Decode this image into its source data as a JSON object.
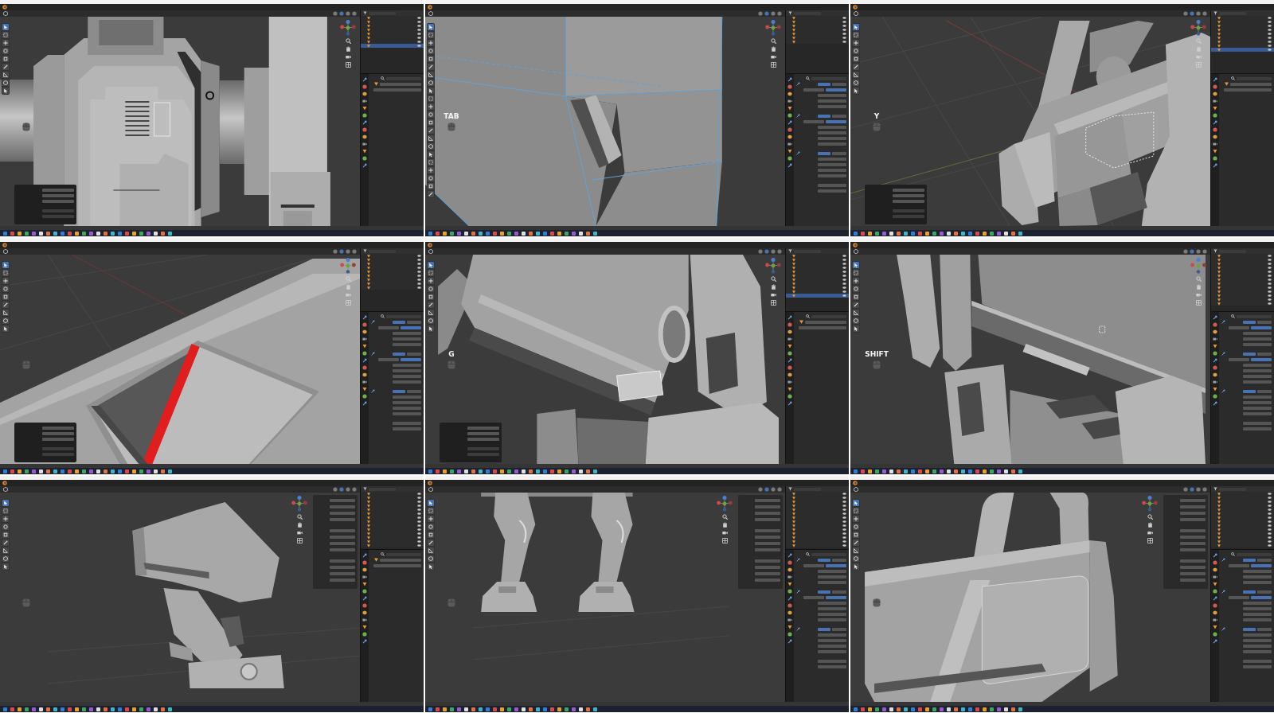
{
  "panels": [
    {
      "kind": "hinge",
      "edit_mode": false,
      "redo_panel": true,
      "modifier_stack": false,
      "outliner_rows": [
        {
          "selected": false
        },
        {
          "selected": false
        },
        {
          "selected": false
        },
        {
          "selected": false
        },
        {
          "selected": false
        },
        {
          "selected": false
        },
        {
          "selected": false
        },
        {
          "selected": true
        }
      ]
    },
    {
      "kind": "edge",
      "edit_mode": true,
      "key_hint": "TAB",
      "modifier_stack": true,
      "outliner_rows": [
        {
          "selected": false
        },
        {
          "selected": false
        },
        {
          "selected": false
        },
        {
          "selected": false
        },
        {
          "selected": false
        },
        {
          "selected": false
        },
        {
          "selected": false
        }
      ]
    },
    {
      "kind": "arm",
      "edit_mode": false,
      "key_hint": "Y",
      "redo_panel": true,
      "modifier_stack": false,
      "outliner_rows": [
        {
          "selected": false
        },
        {
          "selected": false
        },
        {
          "selected": false
        },
        {
          "selected": false
        },
        {
          "selected": false
        },
        {
          "selected": false
        },
        {
          "selected": false
        },
        {
          "selected": false
        },
        {
          "selected": true
        }
      ]
    },
    {
      "kind": "bevel",
      "edit_mode": false,
      "redo_panel": true,
      "modifier_stack": true,
      "outliner_rows": [
        {
          "selected": false
        },
        {
          "selected": false
        },
        {
          "selected": false
        },
        {
          "selected": false
        },
        {
          "selected": false
        },
        {
          "selected": false
        },
        {
          "selected": false
        },
        {
          "selected": false
        },
        {
          "selected": false
        }
      ]
    },
    {
      "kind": "slot",
      "edit_mode": false,
      "key_hint": "G",
      "redo_panel": true,
      "modifier_stack": false,
      "outliner_rows": [
        {
          "selected": false
        },
        {
          "selected": false
        },
        {
          "selected": false
        },
        {
          "selected": false
        },
        {
          "selected": false
        },
        {
          "selected": false
        },
        {
          "selected": false
        },
        {
          "selected": false
        },
        {
          "selected": false
        },
        {
          "selected": false
        },
        {
          "selected": true
        }
      ]
    },
    {
      "kind": "rail",
      "edit_mode": false,
      "key_hint": "SHIFT",
      "modifier_stack": true,
      "outliner_rows": [
        {
          "selected": false
        },
        {
          "selected": false
        },
        {
          "selected": false
        },
        {
          "selected": false
        },
        {
          "selected": false
        },
        {
          "selected": false
        },
        {
          "selected": false
        },
        {
          "selected": false
        },
        {
          "selected": false
        },
        {
          "selected": false
        },
        {
          "selected": false
        },
        {
          "selected": false
        },
        {
          "selected": false
        }
      ]
    },
    {
      "kind": "mech",
      "edit_mode": false,
      "sidebar": true,
      "modifier_stack": false,
      "outliner_rows": [
        {
          "selected": false
        },
        {
          "selected": false
        },
        {
          "selected": false
        },
        {
          "selected": false
        },
        {
          "selected": false
        },
        {
          "selected": false
        },
        {
          "selected": false
        },
        {
          "selected": false
        },
        {
          "selected": false
        },
        {
          "selected": false
        },
        {
          "selected": false
        },
        {
          "selected": false
        },
        {
          "selected": false
        },
        {
          "selected": false
        }
      ]
    },
    {
      "kind": "legs",
      "edit_mode": false,
      "sidebar": true,
      "modifier_stack": true,
      "outliner_rows": [
        {
          "selected": false
        },
        {
          "selected": false
        },
        {
          "selected": false
        },
        {
          "selected": false
        },
        {
          "selected": false
        },
        {
          "selected": false
        },
        {
          "selected": false
        },
        {
          "selected": false
        },
        {
          "selected": false
        },
        {
          "selected": false
        },
        {
          "selected": false
        },
        {
          "selected": false
        },
        {
          "selected": false
        },
        {
          "selected": false
        }
      ]
    },
    {
      "kind": "frame",
      "edit_mode": false,
      "sidebar": true,
      "modifier_stack": true,
      "outliner_rows": [
        {
          "selected": false
        },
        {
          "selected": false
        },
        {
          "selected": false
        },
        {
          "selected": false
        },
        {
          "selected": false
        },
        {
          "selected": false
        },
        {
          "selected": false
        },
        {
          "selected": false
        },
        {
          "selected": false
        },
        {
          "selected": false
        },
        {
          "selected": false
        },
        {
          "selected": false
        },
        {
          "selected": false
        },
        {
          "selected": false
        }
      ]
    }
  ]
}
